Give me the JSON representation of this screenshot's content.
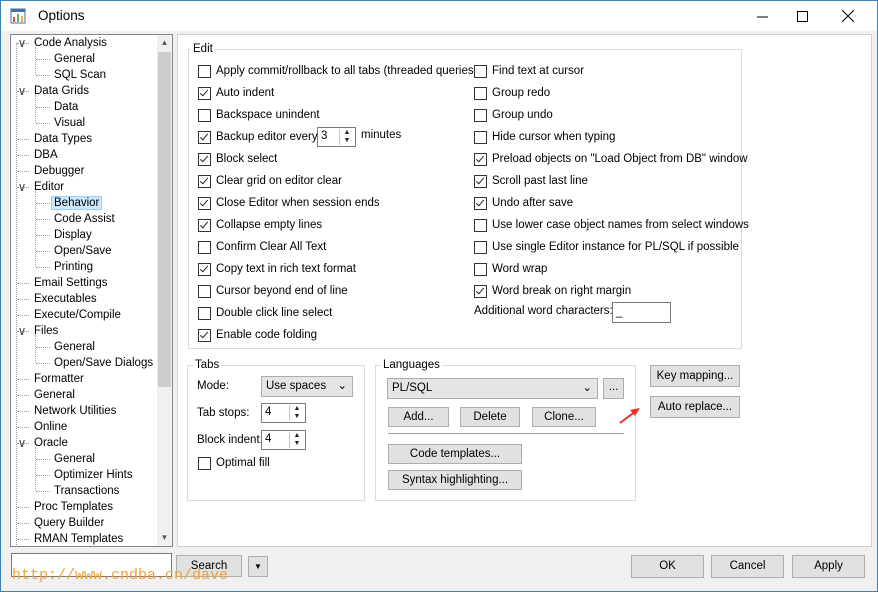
{
  "window": {
    "title": "Options"
  },
  "tree": {
    "items": [
      {
        "label": "Code Analysis",
        "expander": "minus"
      },
      {
        "label": "General"
      },
      {
        "label": "SQL Scan"
      },
      {
        "label": "Data Grids",
        "expander": "minus"
      },
      {
        "label": "Data"
      },
      {
        "label": "Visual"
      },
      {
        "label": "Data Types"
      },
      {
        "label": "DBA"
      },
      {
        "label": "Debugger"
      },
      {
        "label": "Editor",
        "expander": "minus"
      },
      {
        "label": "Behavior",
        "selected": true
      },
      {
        "label": "Code Assist"
      },
      {
        "label": "Display"
      },
      {
        "label": "Open/Save"
      },
      {
        "label": "Printing"
      },
      {
        "label": "Email Settings"
      },
      {
        "label": "Executables"
      },
      {
        "label": "Execute/Compile"
      },
      {
        "label": "Files",
        "expander": "minus"
      },
      {
        "label": "General"
      },
      {
        "label": "Open/Save Dialogs"
      },
      {
        "label": "Formatter"
      },
      {
        "label": "General"
      },
      {
        "label": "Network Utilities"
      },
      {
        "label": "Online"
      },
      {
        "label": "Oracle",
        "expander": "minus"
      },
      {
        "label": "General"
      },
      {
        "label": "Optimizer Hints"
      },
      {
        "label": "Transactions"
      },
      {
        "label": "Proc Templates"
      },
      {
        "label": "Query Builder"
      },
      {
        "label": "RMAN Templates"
      }
    ]
  },
  "edit": {
    "group_label": "Edit",
    "left": [
      {
        "label": "Apply commit/rollback to all tabs (threaded queries)",
        "checked": false
      },
      {
        "label": "Auto indent",
        "checked": true
      },
      {
        "label": "Backspace unindent",
        "checked": false
      },
      {
        "label": "Backup editor every",
        "checked": true
      },
      {
        "label": "Block select",
        "checked": true
      },
      {
        "label": "Clear grid on editor clear",
        "checked": true
      },
      {
        "label": "Close Editor when session ends",
        "checked": true
      },
      {
        "label": "Collapse empty lines",
        "checked": true
      },
      {
        "label": "Confirm Clear All Text",
        "checked": false
      },
      {
        "label": "Copy text in rich text format",
        "checked": true
      },
      {
        "label": "Cursor beyond end of line",
        "checked": false
      },
      {
        "label": "Double click line select",
        "checked": false
      },
      {
        "label": "Enable code folding",
        "checked": true
      }
    ],
    "right": [
      {
        "label": "Find text at cursor",
        "checked": false
      },
      {
        "label": "Group redo",
        "checked": false
      },
      {
        "label": "Group undo",
        "checked": false
      },
      {
        "label": "Hide cursor when typing",
        "checked": false
      },
      {
        "label": "Preload objects on \"Load Object from DB\" window",
        "checked": true
      },
      {
        "label": "Scroll past last line",
        "checked": true
      },
      {
        "label": "Undo after save",
        "checked": true
      },
      {
        "label": "Use lower case object names from select windows",
        "checked": false
      },
      {
        "label": "Use single Editor instance for PL/SQL if possible",
        "checked": false
      },
      {
        "label": "Word wrap",
        "checked": false
      },
      {
        "label": "Word break on right margin",
        "checked": true
      }
    ],
    "backup_minutes": "3",
    "minutes_label": "minutes",
    "additional_label": "Additional word characters:",
    "additional_value": "_"
  },
  "tabs": {
    "group_label": "Tabs",
    "mode_label": "Mode:",
    "mode_value": "Use spaces",
    "tab_stops_label": "Tab stops:",
    "tab_stops_value": "4",
    "block_indent_label": "Block indent:",
    "block_indent_value": "4",
    "optimal_fill_label": "Optimal fill",
    "optimal_fill_checked": false
  },
  "languages": {
    "group_label": "Languages",
    "selected": "PL/SQL",
    "ellipsis": "...",
    "add": "Add...",
    "delete": "Delete",
    "clone": "Clone...",
    "code_templates": "Code templates...",
    "syntax_highlighting": "Syntax highlighting..."
  },
  "side_buttons": {
    "key_mapping": "Key mapping...",
    "auto_replace": "Auto replace..."
  },
  "bottom": {
    "search_value": "",
    "search_button": "Search",
    "ok": "OK",
    "cancel": "Cancel",
    "apply": "Apply"
  },
  "watermark": "http://www.cndba.cn/dave",
  "colors": {
    "accent": "#0078d7",
    "arrow": "#e8322a",
    "watermark": "#f2a23c"
  }
}
